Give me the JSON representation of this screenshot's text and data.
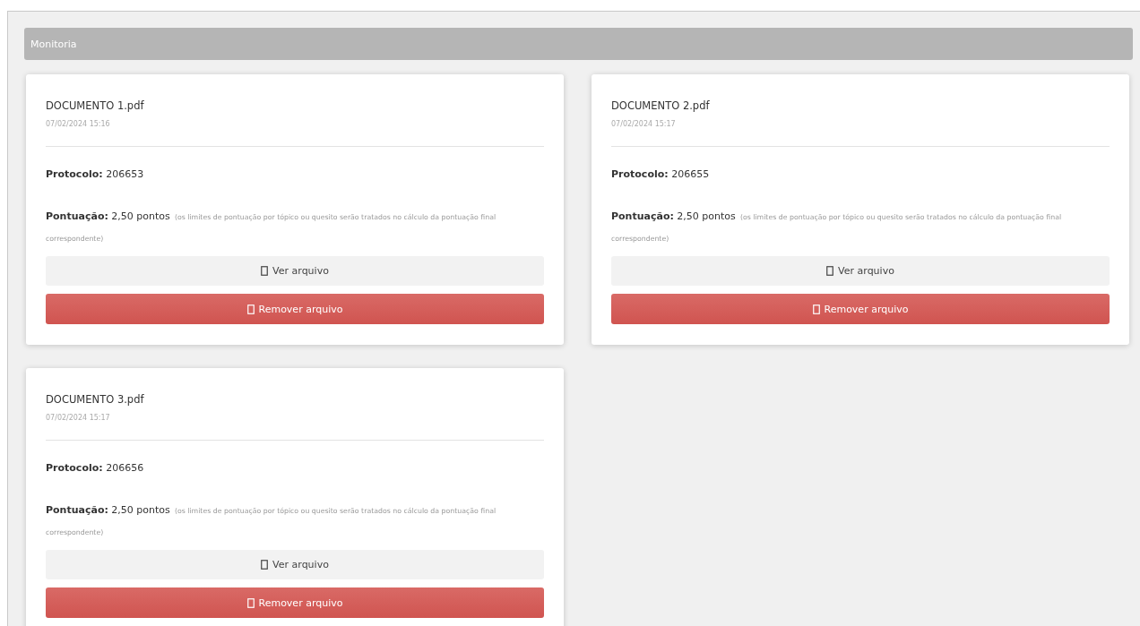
{
  "panel": {
    "title": "Monitoria"
  },
  "documents": [
    {
      "filename": "DOCUMENTO 1.pdf",
      "date": "07/02/2024 15:16",
      "protocol": "**Protocolo:** 206653",
      "score": "**Pontuação:** 2,50 pontos",
      "note": "(os limites de pontuação por tópico ou quesito serão tratados no cálculo da pontuação final correspondente)",
      "view_button": "Ver arquivo",
      "remove_button": "Remover arquivo"
    },
    {
      "filename": "DOCUMENTO 2.pdf",
      "date": "07/02/2024 15:17",
      "protocol": "**Protocolo:** 206655",
      "score": "**Pontuação:** 2,50 pontos",
      "note": "(os limites de pontuação por tópico ou quesito serão tratados no cálculo da pontuação final correspondente)",
      "view_button": "Ver arquivo",
      "remove_button": "Remover arquivo"
    },
    {
      "filename": "DOCUMENTO 3.pdf",
      "date": "07/02/2024 15:17",
      "protocol": "**Protocolo:** 206656",
      "score": "**Pontuação:** 2,50 pontos",
      "note": "(os limites de pontuação por tópico ou quesito serão tratados no cálculo da pontuação final correspondente)",
      "view_button": "Ver arquivo",
      "remove_button": "Remover arquivo"
    }
  ]
}
